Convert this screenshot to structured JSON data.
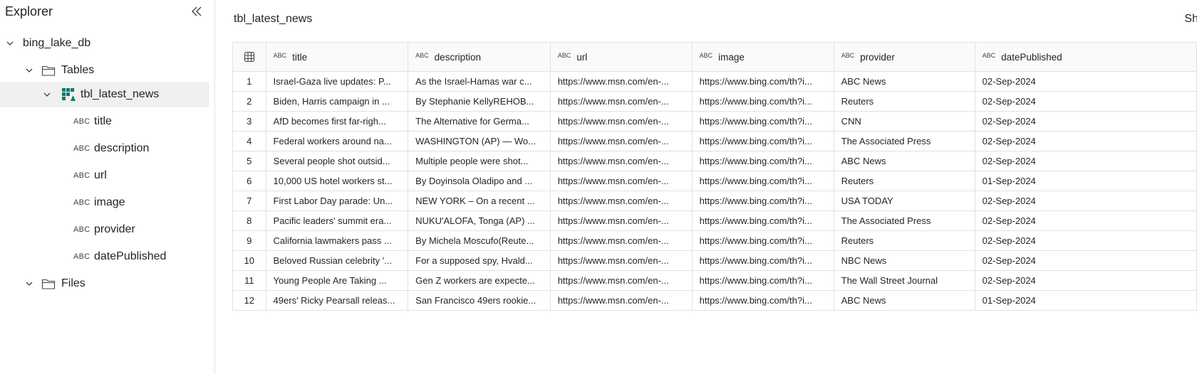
{
  "sidebar": {
    "title": "Explorer",
    "database": "bing_lake_db",
    "tables_folder": "Tables",
    "table": "tbl_latest_news",
    "columns": [
      {
        "type": "ABC",
        "name": "title"
      },
      {
        "type": "ABC",
        "name": "description"
      },
      {
        "type": "ABC",
        "name": "url"
      },
      {
        "type": "ABC",
        "name": "image"
      },
      {
        "type": "ABC",
        "name": "provider"
      },
      {
        "type": "ABC",
        "name": "datePublished"
      }
    ],
    "files_folder": "Files"
  },
  "main": {
    "title": "tbl_latest_news",
    "right_cut_text": "Sh",
    "grid": {
      "type_label": "ABC",
      "columns": [
        "title",
        "description",
        "url",
        "image",
        "provider",
        "datePublished"
      ],
      "rows": [
        {
          "n": "1",
          "cells": [
            "Israel-Gaza live updates: P...",
            "As the Israel-Hamas war c...",
            "https://www.msn.com/en-...",
            "https://www.bing.com/th?i...",
            "ABC News",
            "02-Sep-2024"
          ]
        },
        {
          "n": "2",
          "cells": [
            "Biden, Harris campaign in ...",
            "By Stephanie KellyREHOB...",
            "https://www.msn.com/en-...",
            "https://www.bing.com/th?i...",
            "Reuters",
            "02-Sep-2024"
          ]
        },
        {
          "n": "3",
          "cells": [
            "AfD becomes first far-righ...",
            "The Alternative for Germa...",
            "https://www.msn.com/en-...",
            "https://www.bing.com/th?i...",
            "CNN",
            "02-Sep-2024"
          ]
        },
        {
          "n": "4",
          "cells": [
            "Federal workers around na...",
            "WASHINGTON (AP) — Wo...",
            "https://www.msn.com/en-...",
            "https://www.bing.com/th?i...",
            "The Associated Press",
            "02-Sep-2024"
          ]
        },
        {
          "n": "5",
          "cells": [
            "Several people shot outsid...",
            "Multiple people were shot...",
            "https://www.msn.com/en-...",
            "https://www.bing.com/th?i...",
            "ABC News",
            "02-Sep-2024"
          ]
        },
        {
          "n": "6",
          "cells": [
            "10,000 US hotel workers st...",
            "By Doyinsola Oladipo and ...",
            "https://www.msn.com/en-...",
            "https://www.bing.com/th?i...",
            "Reuters",
            "01-Sep-2024"
          ]
        },
        {
          "n": "7",
          "cells": [
            "First Labor Day parade: Un...",
            "NEW YORK – On a recent ...",
            "https://www.msn.com/en-...",
            "https://www.bing.com/th?i...",
            "USA TODAY",
            "02-Sep-2024"
          ]
        },
        {
          "n": "8",
          "cells": [
            "Pacific leaders' summit era...",
            "NUKU'ALOFA, Tonga (AP) ...",
            "https://www.msn.com/en-...",
            "https://www.bing.com/th?i...",
            "The Associated Press",
            "02-Sep-2024"
          ]
        },
        {
          "n": "9",
          "cells": [
            "California lawmakers pass ...",
            "By Michela Moscufo(Reute...",
            "https://www.msn.com/en-...",
            "https://www.bing.com/th?i...",
            "Reuters",
            "02-Sep-2024"
          ]
        },
        {
          "n": "10",
          "cells": [
            "Beloved Russian celebrity '...",
            "For a supposed spy, Hvald...",
            "https://www.msn.com/en-...",
            "https://www.bing.com/th?i...",
            "NBC News",
            "02-Sep-2024"
          ]
        },
        {
          "n": "11",
          "cells": [
            "Young People Are Taking ...",
            "Gen Z workers are expecte...",
            "https://www.msn.com/en-...",
            "https://www.bing.com/th?i...",
            "The Wall Street Journal",
            "02-Sep-2024"
          ]
        },
        {
          "n": "12",
          "cells": [
            "49ers' Ricky Pearsall releas...",
            "San Francisco 49ers rookie...",
            "https://www.msn.com/en-...",
            "https://www.bing.com/th?i...",
            "ABC News",
            "01-Sep-2024"
          ]
        }
      ]
    }
  }
}
